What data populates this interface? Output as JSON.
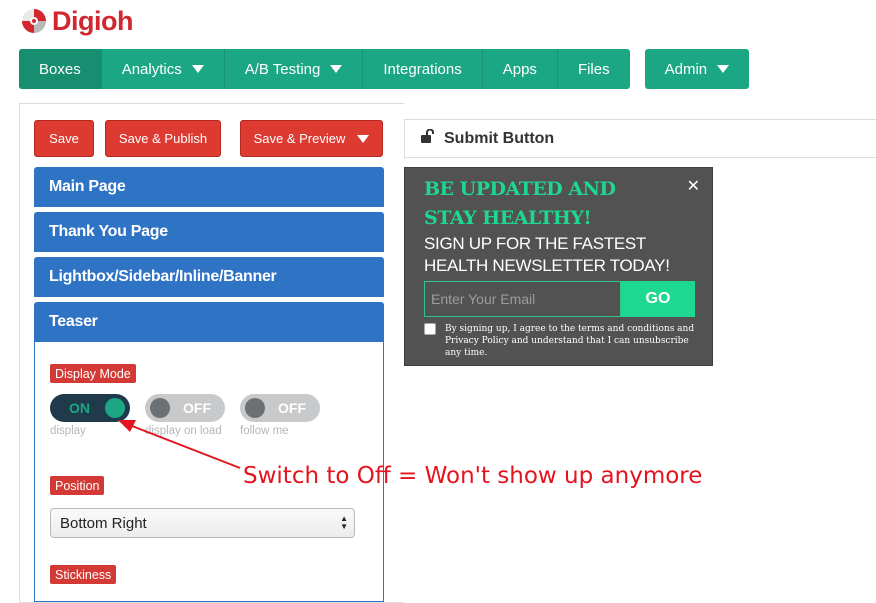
{
  "app": {
    "logo_text": "Digioh",
    "brand_color": "#d0282e",
    "accent_color": "#1ba784"
  },
  "nav": {
    "items": [
      {
        "label": "Boxes",
        "active": true
      },
      {
        "label": "Analytics",
        "dropdown": true
      },
      {
        "label": "A/B Testing",
        "dropdown": true
      },
      {
        "label": "Integrations"
      },
      {
        "label": "Apps"
      },
      {
        "label": "Files"
      }
    ],
    "admin": {
      "label": "Admin",
      "dropdown": true
    }
  },
  "toolbar": {
    "save_label": "Save",
    "save_publish_label": "Save & Publish",
    "save_preview_label": "Save & Preview"
  },
  "sections": {
    "main_page": "Main Page",
    "thank_you_page": "Thank You Page",
    "lightbox": "Lightbox/Sidebar/Inline/Banner",
    "teaser": "Teaser"
  },
  "teaser": {
    "display_mode_label": "Display Mode",
    "toggles": [
      {
        "state": "ON",
        "caption": "display"
      },
      {
        "state": "OFF",
        "caption": "display on load"
      },
      {
        "state": "OFF",
        "caption": "follow me"
      }
    ],
    "position_label": "Position",
    "position_value": "Bottom Right",
    "stickiness_label": "Stickiness"
  },
  "right_panel": {
    "title": "Submit Button",
    "icon": "unlock-icon"
  },
  "preview": {
    "headline_line1": "BE UPDATED AND",
    "headline_line2": "STAY HEALTHY!",
    "sub_line1": "SIGN UP FOR THE FASTEST",
    "sub_line2": "HEALTH NEWSLETTER TODAY!",
    "email_placeholder": "Enter Your Email",
    "go_label": "GO",
    "close_glyph": "✕",
    "terms": "By signing up, I agree to the terms and conditions and Privacy Policy and understand that I can unsubscribe any time."
  },
  "annotation": {
    "text": "Switch to Off = Won't show up anymore",
    "color": "#e3141e"
  }
}
